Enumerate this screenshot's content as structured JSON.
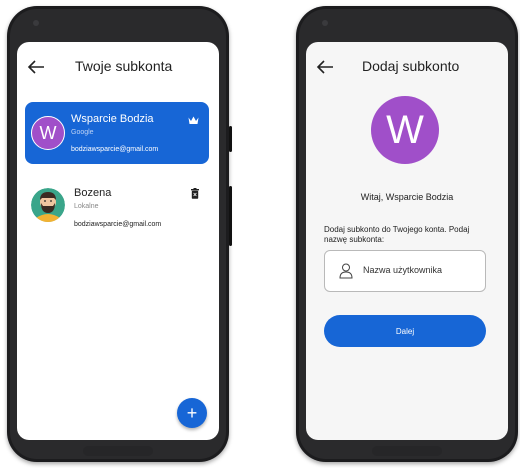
{
  "colors": {
    "accent": "#1766d6",
    "avatar_purple": "#a04fc9"
  },
  "left": {
    "title": "Twoje subkonta",
    "accounts": [
      {
        "initial": "W",
        "name": "Wsparcie Bodzia",
        "type": "Google",
        "email": "bodziawsparcie@gmail.com",
        "icon": "crown-icon"
      },
      {
        "name": "Bozena",
        "type": "Lokalne",
        "email": "bodziawsparcie@gmail.com",
        "icon": "trash-icon"
      }
    ],
    "fab_label": "+"
  },
  "right": {
    "title": "Dodaj subkonto",
    "avatar_initial": "W",
    "welcome": "Witaj, Wsparcie Bodzia",
    "description": "Dodaj subkonto do Twojego konta. Podaj nazwę subkonta:",
    "input_placeholder": "Nazwa użytkownika",
    "next_button": "Dalej"
  }
}
